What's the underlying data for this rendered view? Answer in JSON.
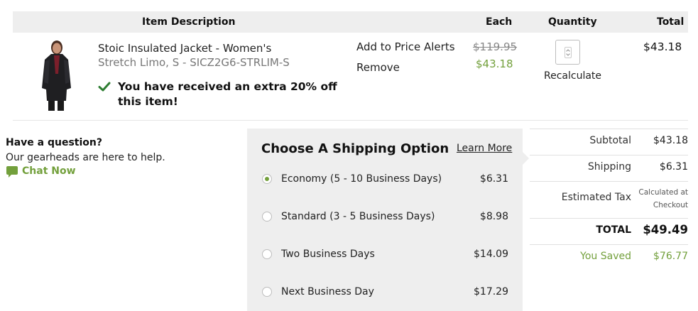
{
  "table_header": {
    "description": "Item Description",
    "each": "Each",
    "quantity": "Quantity",
    "total": "Total"
  },
  "item": {
    "name": "Stoic Insulated Jacket - Women's",
    "variant": "Stretch Limo, S - SICZ2G6-STRLIM-S",
    "promo": "You have received an extra 20% off this item!",
    "add_to_alerts": "Add to Price Alerts",
    "remove": "Remove",
    "original_price": "$119.95",
    "sale_price": "$43.18",
    "quantity": "",
    "recalculate": "Recalculate",
    "line_total": "$43.18",
    "image_icon": "jacket-photo"
  },
  "help": {
    "title": "Have a question?",
    "subtitle": "Our gearheads are here to help.",
    "chat": "Chat Now"
  },
  "shipping": {
    "title": "Choose A Shipping Option",
    "learn_more": "Learn More",
    "options": [
      {
        "label": "Economy (5 - 10 Business Days)",
        "price": "$6.31",
        "selected": true
      },
      {
        "label": "Standard (3 - 5 Business Days)",
        "price": "$8.98",
        "selected": false
      },
      {
        "label": "Two Business Days",
        "price": "$14.09",
        "selected": false
      },
      {
        "label": "Next Business Day",
        "price": "$17.29",
        "selected": false
      }
    ]
  },
  "summary": {
    "subtotal_label": "Subtotal",
    "subtotal": "$43.18",
    "shipping_label": "Shipping",
    "shipping": "$6.31",
    "tax_label": "Estimated Tax",
    "tax_line1": "Calculated at",
    "tax_line2": "Checkout",
    "total_label": "TOTAL",
    "total": "$49.49",
    "saved_label": "You Saved",
    "saved": "$76.77"
  },
  "colors": {
    "accent_green": "#73a03c",
    "header_gray": "#eeeeee"
  }
}
